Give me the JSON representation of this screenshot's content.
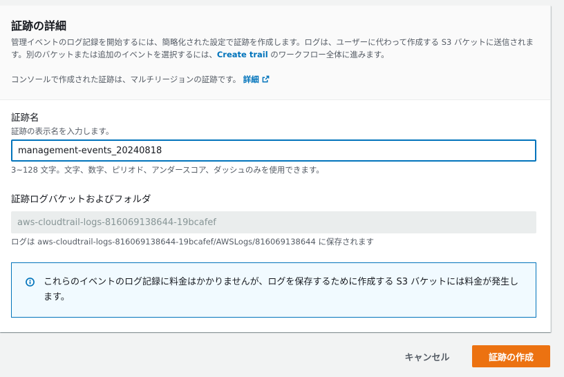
{
  "panel": {
    "title": "証跡の詳細",
    "description_part1": "管理イベントのログ記録を開始するには、簡略化された設定で証跡を作成します。ログは、ユーザーに代わって作成する S3 バケットに送信されます。別のバケットまたは追加のイベントを選択するには、",
    "description_link": "Create trail",
    "description_part2": " のワークフロー全体に進みます。",
    "note_text": "コンソールで作成された証跡は、マルチリージョンの証跡です。",
    "note_link": "詳細"
  },
  "trail_name": {
    "label": "証跡名",
    "description": "証跡の表示名を入力します。",
    "value": "management-events_20240818",
    "constraint": "3~128 文字。文字、数字、ピリオド、アンダースコア、ダッシュのみを使用できます。"
  },
  "bucket": {
    "label": "証跡ログバケットおよびフォルダ",
    "value": "aws-cloudtrail-logs-816069138644-19bcafef",
    "hint": "ログは aws-cloudtrail-logs-816069138644-19bcafef/AWSLogs/816069138644 に保存されます"
  },
  "info": {
    "text": "これらのイベントのログ記録に料金はかかりませんが、ログを保存するために作成する S3 バケットには料金が発生します。",
    "icon": "info-icon"
  },
  "actions": {
    "cancel_label": "キャンセル",
    "create_label": "証跡の作成"
  },
  "colors": {
    "link": "#0073bb",
    "primary_button": "#ec7211",
    "info_border": "#0073bb",
    "info_background": "#f1faff"
  }
}
